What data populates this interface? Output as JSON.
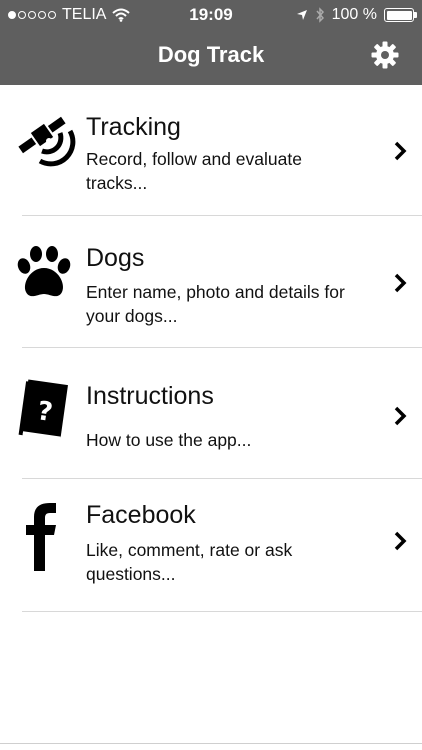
{
  "status_bar": {
    "carrier": "TELIA",
    "signal_filled": 1,
    "signal_total": 5,
    "time": "19:09",
    "battery": "100 %",
    "battery_level": 1.0
  },
  "nav": {
    "title": "Dog Track",
    "settings_icon": "gear-icon"
  },
  "menu": {
    "items": [
      {
        "icon": "satellite-tracking-icon",
        "title": "Tracking",
        "description": "Record, follow and evaluate tracks..."
      },
      {
        "icon": "paw-icon",
        "title": "Dogs",
        "description": "Enter name, photo and details for your dogs..."
      },
      {
        "icon": "help-book-icon",
        "title": "Instructions",
        "description": "How to use the app..."
      },
      {
        "icon": "facebook-icon",
        "title": "Facebook",
        "description": "Like, comment, rate or ask questions..."
      }
    ]
  },
  "colors": {
    "topbar": "#5f5f5f",
    "text": "#111111",
    "divider": "#d8d8d8"
  }
}
